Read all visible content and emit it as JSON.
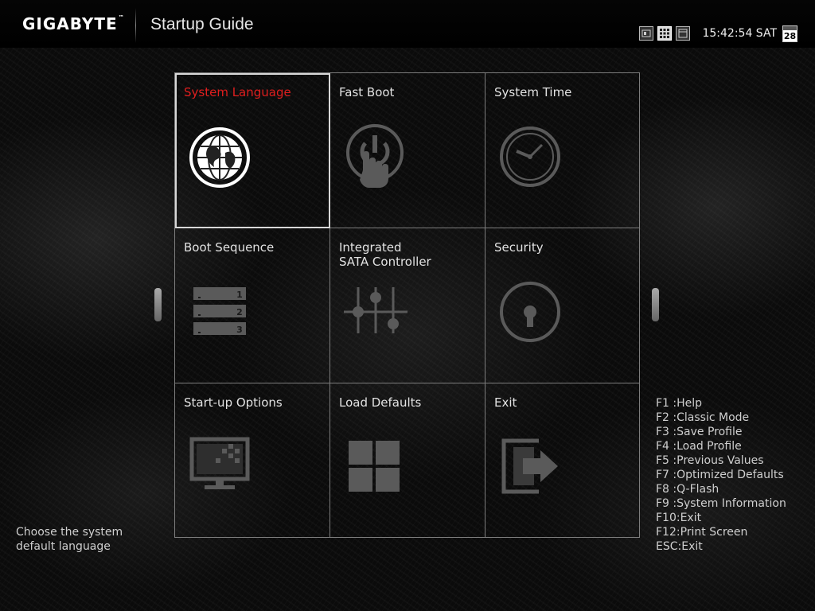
{
  "header": {
    "brand": "GIGABYTE",
    "trademark": "™",
    "title": "Startup Guide",
    "view_modes": [
      {
        "name": "easy-mode",
        "active": false
      },
      {
        "name": "grid-mode",
        "active": true
      },
      {
        "name": "classic-mode",
        "active": false
      }
    ],
    "time": "15:42:54 SAT",
    "date_day": "28"
  },
  "tiles": [
    {
      "label": "System Language",
      "icon": "globe-icon",
      "selected": true
    },
    {
      "label": "Fast Boot",
      "icon": "power-touch-icon",
      "selected": false
    },
    {
      "label": "System Time",
      "icon": "clock-icon",
      "selected": false
    },
    {
      "label": "Boot Sequence",
      "icon": "boot-order-icon",
      "selected": false
    },
    {
      "label": "Integrated\nSATA Controller",
      "icon": "sliders-icon",
      "selected": false
    },
    {
      "label": "Security",
      "icon": "lock-icon",
      "selected": false
    },
    {
      "label": "Start-up Options",
      "icon": "monitor-icon",
      "selected": false
    },
    {
      "label": "Load Defaults",
      "icon": "windows-grid-icon",
      "selected": false
    },
    {
      "label": "Exit",
      "icon": "exit-door-icon",
      "selected": false
    }
  ],
  "boot_numbers": [
    "1",
    "2",
    "3"
  ],
  "help_text": "Choose the system default language",
  "hotkeys": [
    "F1 :Help",
    "F2 :Classic Mode",
    "F3 :Save Profile",
    "F4 :Load Profile",
    "F5 :Previous Values",
    "F7 :Optimized Defaults",
    "F8 :Q-Flash",
    "F9 :System Information",
    "F10:Exit",
    "F12:Print Screen",
    "ESC:Exit"
  ],
  "colors": {
    "selected_label": "#e01e1e",
    "grid_line": "#7d7d7d",
    "icon_active": "#ffffff",
    "icon_inactive": "#5a5a5a"
  }
}
